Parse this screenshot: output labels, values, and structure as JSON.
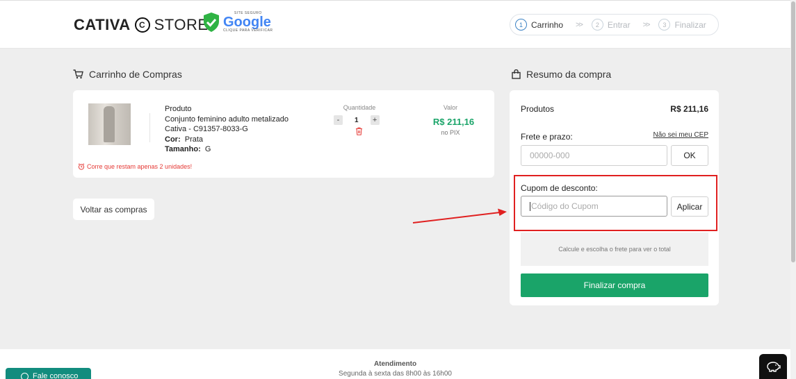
{
  "header": {
    "logo_bold": "CATIVA",
    "logo_mark": "C",
    "logo_light": "STORE",
    "badge_top": "SITE SEGURO",
    "badge_main": "Google",
    "badge_bottom": "CLIQUE PARA VERIFICAR",
    "steps": [
      {
        "num": "1",
        "label": "Carrinho"
      },
      {
        "num": "2",
        "label": "Entrar"
      },
      {
        "num": "3",
        "label": "Finalizar"
      }
    ],
    "step_separator": ">>"
  },
  "cart": {
    "title": "Carrinho de Compras",
    "product": {
      "heading": "Produto",
      "name": "Conjunto feminino adulto metalizado",
      "ref": "Cativa - C91357-8033-G",
      "color_label": "Cor:",
      "color_value": "Prata",
      "size_label": "Tamanho:",
      "size_value": "G",
      "qty_label": "Quantidade",
      "qty_minus": "-",
      "qty_value": "1",
      "qty_plus": "+",
      "value_label": "Valor",
      "price": "R$ 211,16",
      "price_note": "no PIX",
      "stock_warning": "Corre que restam apenas 2 unidades!"
    },
    "back_button": "Voltar as compras"
  },
  "summary": {
    "title": "Resumo da compra",
    "products_label": "Produtos",
    "products_value": "R$ 211,16",
    "shipping_label": "Frete e prazo:",
    "cep_link": "Não sei meu CEP",
    "cep_placeholder": "00000-000",
    "ok_button": "OK",
    "coupon_label": "Cupom de desconto:",
    "coupon_placeholder": "Código do Cupom",
    "apply_button": "Aplicar",
    "total_note": "Calcule e escolha o frete para ver o total",
    "checkout_button": "Finalizar compra"
  },
  "footer": {
    "title": "Atendimento",
    "hours": "Segunda à sexta das 8h00 às 16h00"
  },
  "chat_button": "Fale conosco",
  "colors": {
    "accent_green": "#1aa469",
    "warning_red": "#e53935",
    "annotation_red": "#e02020",
    "whatsapp_green": "#128c7e"
  }
}
